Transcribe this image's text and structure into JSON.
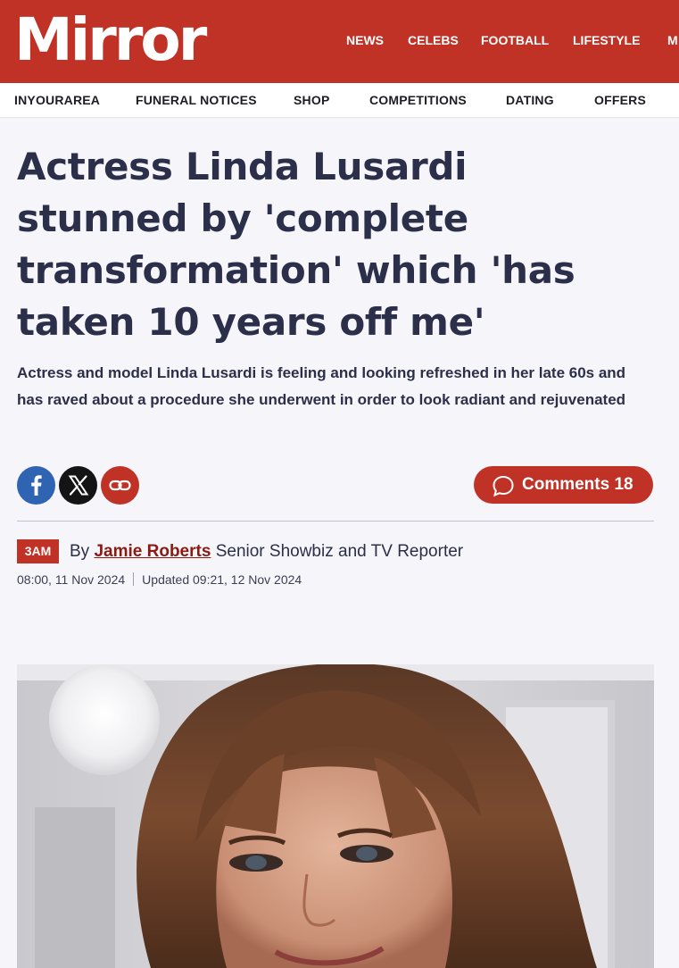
{
  "site": {
    "logo": "Mirror"
  },
  "nav": {
    "main": [
      "NEWS",
      "CELEBS",
      "FOOTBALL",
      "LIFESTYLE",
      "M"
    ],
    "sub": [
      "INYOURAREA",
      "FUNERAL NOTICES",
      "SHOP",
      "COMPETITIONS",
      "DATING",
      "OFFERS"
    ]
  },
  "article": {
    "headline": "Actress Linda Lusardi stunned by 'complete transformation' which 'has taken 10 years off me'",
    "standfirst": "Actress and model Linda Lusardi is feeling and looking refreshed in her late 60s and has raved about a procedure she underwent in order to look radiant and rejuvenated",
    "comments_label": "Comments 18",
    "badge": "3AM",
    "by_prefix": "By",
    "author": "Jamie Roberts",
    "author_role": "Senior Showbiz and TV Reporter",
    "published": "08:00, 11 Nov 2024",
    "updated": "Updated 09:21, 12 Nov 2024"
  },
  "share": {
    "icons": [
      "facebook-icon",
      "x-icon",
      "link-icon"
    ]
  },
  "colors": {
    "brand_red": "#c03226",
    "headline_navy": "#2b2f4a",
    "facebook_blue": "#2f64b2",
    "x_black": "#141414",
    "author_link": "#8a1a12"
  }
}
